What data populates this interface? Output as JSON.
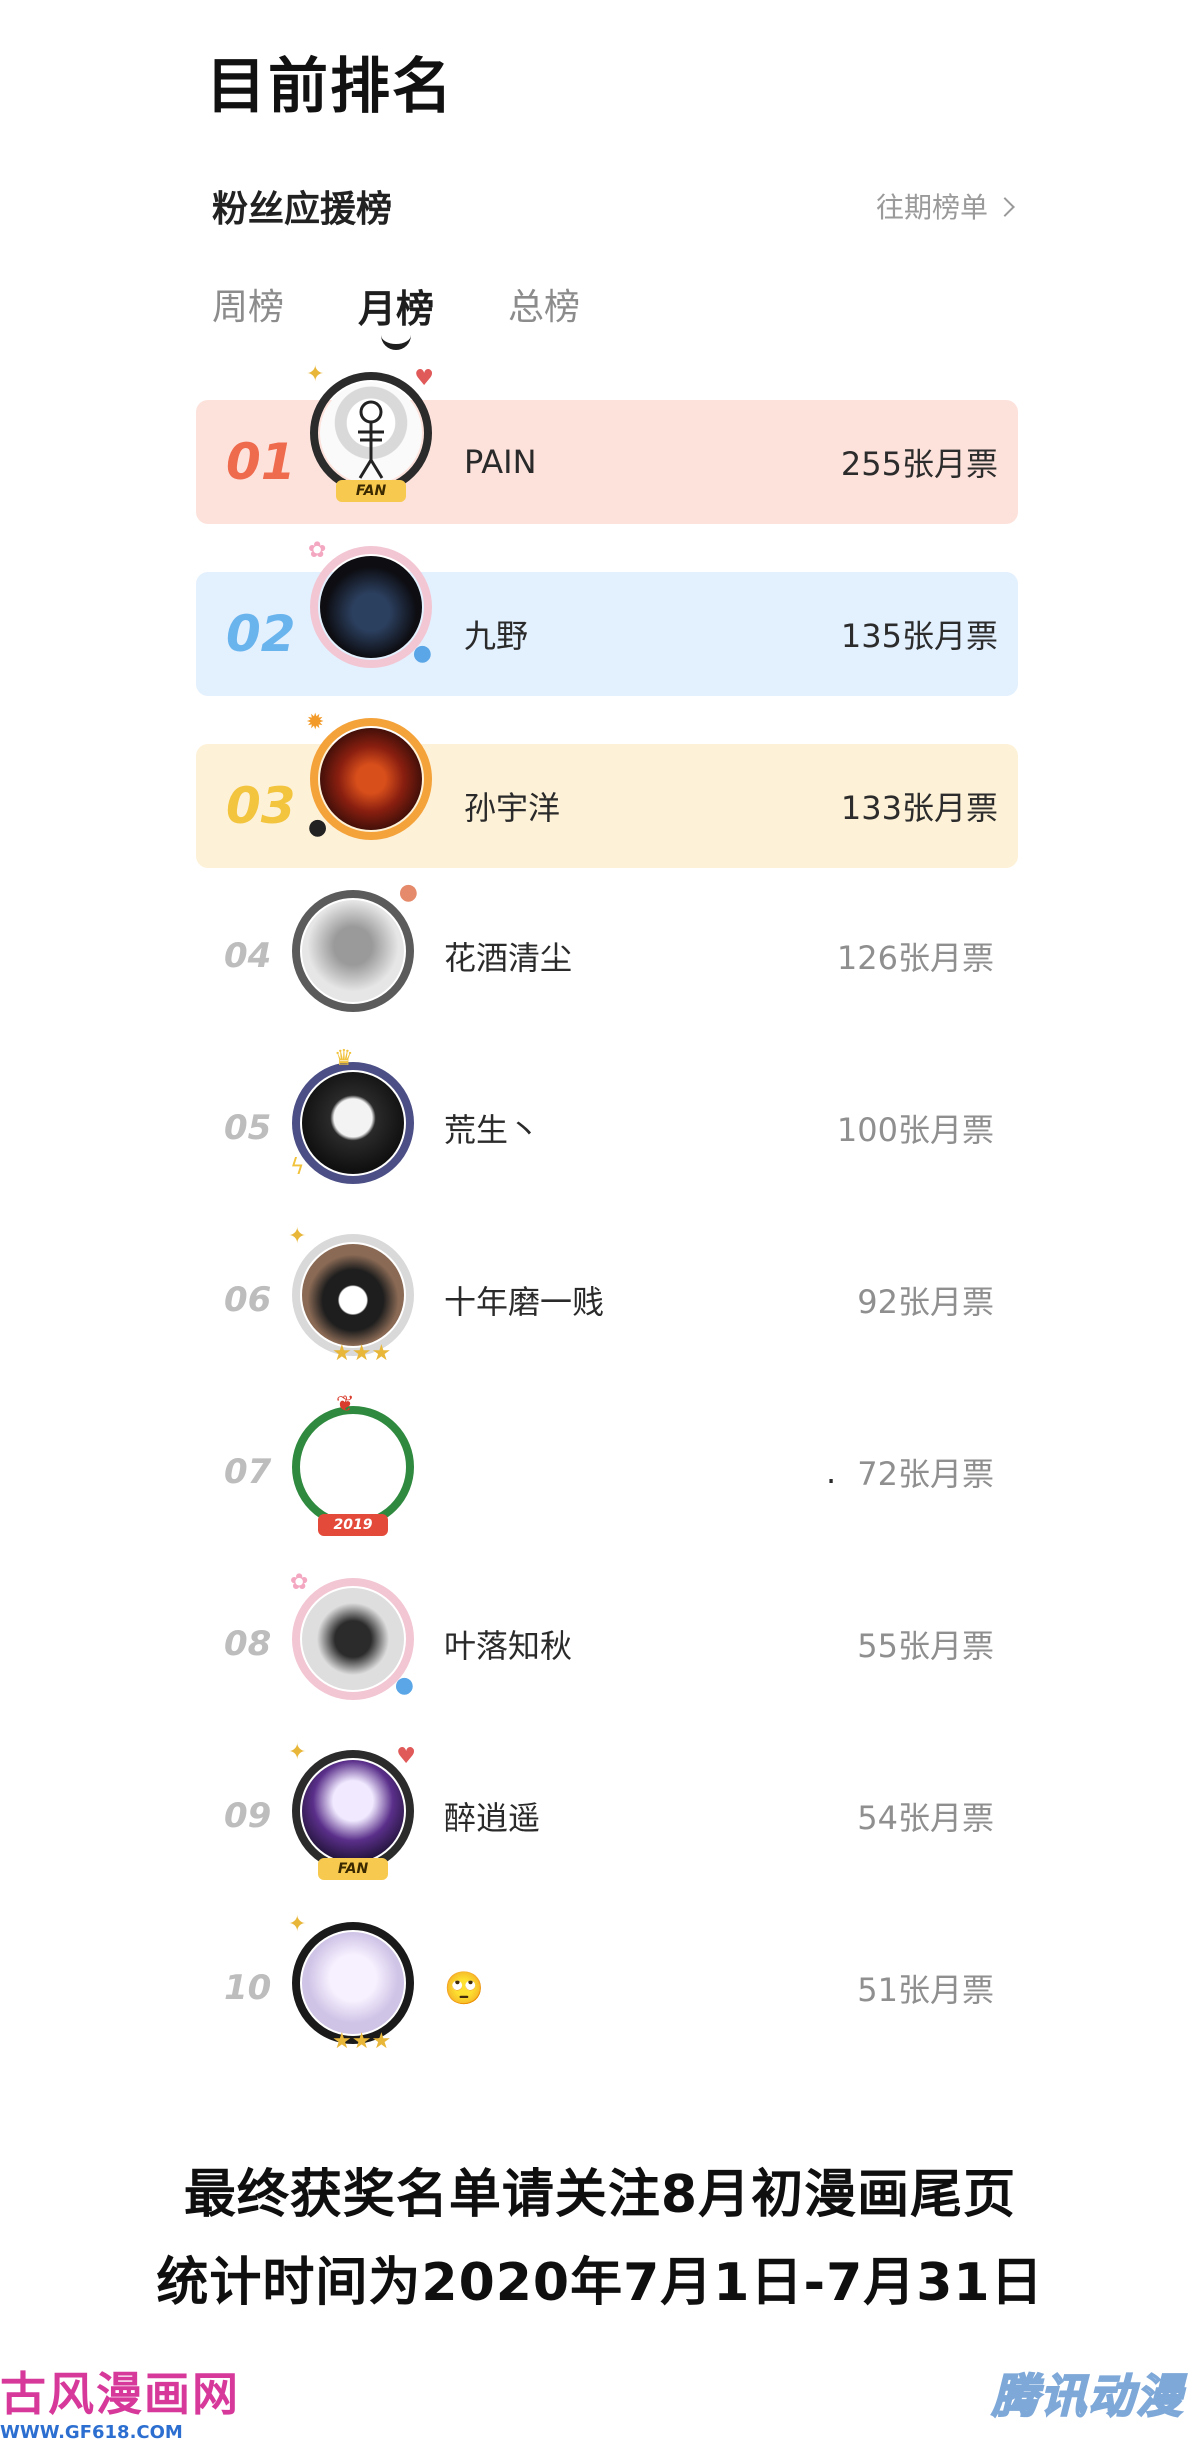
{
  "header": {
    "title": "目前排名"
  },
  "board": {
    "title": "粉丝应援榜",
    "history_link": "往期榜单"
  },
  "tabs": [
    {
      "label": "周榜",
      "active": false
    },
    {
      "label": "月榜",
      "active": true
    },
    {
      "label": "总榜",
      "active": false
    }
  ],
  "ranks": [
    {
      "rank": "01",
      "name": "PAIN",
      "votes": "255张月票",
      "badge": "FAN"
    },
    {
      "rank": "02",
      "name": "九野",
      "votes": "135张月票"
    },
    {
      "rank": "03",
      "name": "孙宇洋",
      "votes": "133张月票"
    },
    {
      "rank": "04",
      "name": "花酒清尘",
      "votes": "126张月票"
    },
    {
      "rank": "05",
      "name": "荒生丶",
      "votes": "100张月票"
    },
    {
      "rank": "06",
      "name": "十年磨一贱",
      "votes": "92张月票"
    },
    {
      "rank": "07",
      "name": ".",
      "votes": "72张月票",
      "badge": "2019"
    },
    {
      "rank": "08",
      "name": "叶落知秋",
      "votes": "55张月票"
    },
    {
      "rank": "09",
      "name": "醉逍遥",
      "votes": "54张月票",
      "badge": "FAN"
    },
    {
      "rank": "10",
      "name": "🙄",
      "votes": "51张月票"
    }
  ],
  "footer": {
    "line1": "最终获奖名单请关注8月初漫画尾页",
    "line2": "统计时间为2020年7月1日-7月31日"
  },
  "watermarks": {
    "left_title": "古风漫画网",
    "left_url": "WWW.GF618.COM",
    "right": "腾讯动漫"
  },
  "colors": {
    "rank1_bg": "#fde2dc",
    "rank2_bg": "#e3f0fe",
    "rank3_bg": "#fdf1d7",
    "rank1": "#ef6b4e",
    "rank2": "#6ab4ee",
    "rank3": "#f3c43e"
  }
}
